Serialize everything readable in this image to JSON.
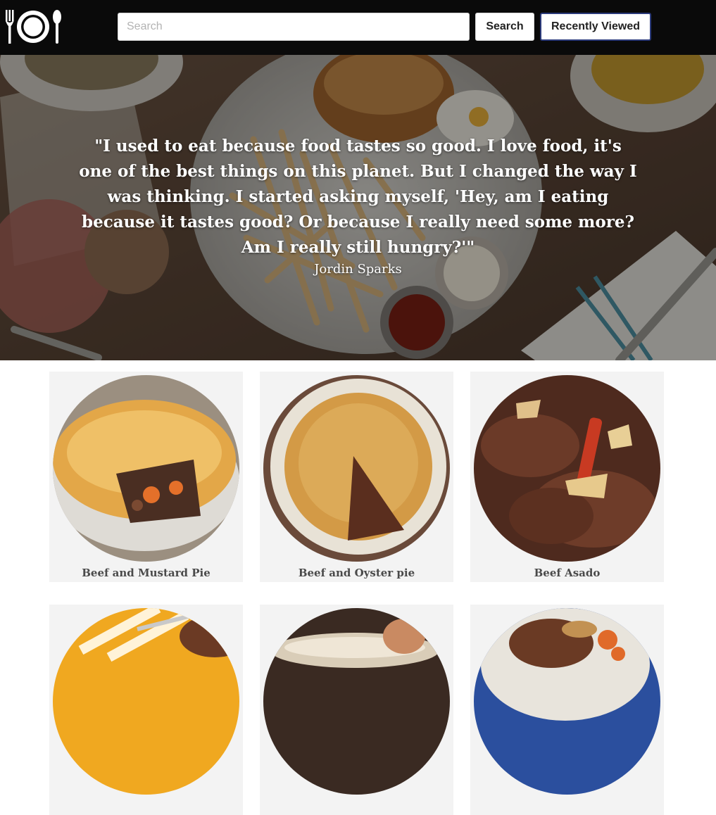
{
  "header": {
    "search_placeholder": "Search",
    "search_button": "Search",
    "recent_button": "Recently Viewed",
    "logo_icon": "fork-plate-spoon-icon"
  },
  "hero": {
    "quote": "\"I used to eat because food tastes so good. I love food, it's one of the best things on this planet. But I changed the way I was thinking. I started asking myself, 'Hey, am I eating because it tastes good? Or because I really need some more? Am I really still hungry?'\"",
    "author": "Jordin Sparks"
  },
  "recipes": [
    {
      "name": "Beef and Mustard Pie"
    },
    {
      "name": "Beef and Oyster pie"
    },
    {
      "name": "Beef Asado"
    },
    {
      "name": ""
    },
    {
      "name": ""
    },
    {
      "name": ""
    }
  ],
  "colors": {
    "navbar": "#0a0a0a",
    "card_bg": "#f3f3f3",
    "recent_border": "#2b3a7a"
  }
}
